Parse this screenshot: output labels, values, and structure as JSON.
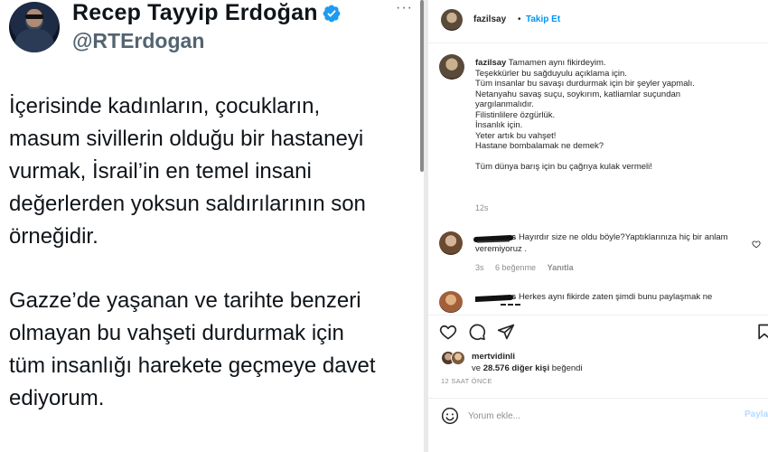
{
  "tweet": {
    "name": "Recep Tayyip Erdoğan",
    "handle": "@RTErdogan",
    "more_icon": "more-horizontal-icon",
    "verified_icon": "verified-badge-icon",
    "verified_color": "#1d9bf0",
    "paragraphs": [
      "İçerisinde kadınların, çocukların,\nmasum sivillerin olduğu bir hastaneyi\nvurmak, İsrail’in en temel insani\ndeğerlerden yoksun saldırılarının son\nörneğidir.",
      "Gazze’de yaşanan ve tarihte benzeri\nolmayan bu vahşeti durdurmak için\ntüm insanlığı harekete geçmeye davet\nediyorum."
    ]
  },
  "instagram": {
    "header": {
      "username": "fazilsay",
      "separator": "•",
      "follow_label": "Takip Et",
      "follow_color": "#0095f6"
    },
    "caption": {
      "username": "fazilsay",
      "first_line": "Tamamen aynı fikirdeyim.",
      "lines": [
        "Teşekkürler bu sağduyulu açıklama için.",
        "Tüm insanlar bu savaşı durdurmak için bir şeyler yapmalı.",
        "Netanyahu savaş suçu, soykırım, katliamlar suçundan",
        "yargılanmalıdır.",
        "Filistinlilere özgürlük.",
        "İnsanlık için.",
        "Yeter artık bu vahşet!",
        "Hastane bombalamak ne demek?"
      ],
      "last_line": "Tüm dünya barış için bu çağrıya kulak vermeli!",
      "time": "12s"
    },
    "comments": [
      {
        "username_suffix": "s",
        "text": "Hayırdır size ne oldu böyle?Yaptıklarınıza hiç bir anlam veremiyoruz .",
        "time": "3s",
        "likes": "6 beğenme",
        "reply": "Yanıtla"
      },
      {
        "username_suffix": "s",
        "text": "Herkes aynı fikirde zaten şimdi bunu paylaşmak ne"
      }
    ],
    "actions": {
      "like_icon": "heart-icon",
      "comment_icon": "comment-icon",
      "share_icon": "share-icon"
    },
    "likes": {
      "user": "mertvidinli",
      "prefix": "ve ",
      "count": "28.576 diğer kişi",
      "suffix": " beğendi"
    },
    "posted_ago": "12 SAAT ÖNCE",
    "add_comment": {
      "emoji_icon": "emoji-icon",
      "placeholder": "Yorum ekle...",
      "post_label": "Paylaş"
    }
  }
}
